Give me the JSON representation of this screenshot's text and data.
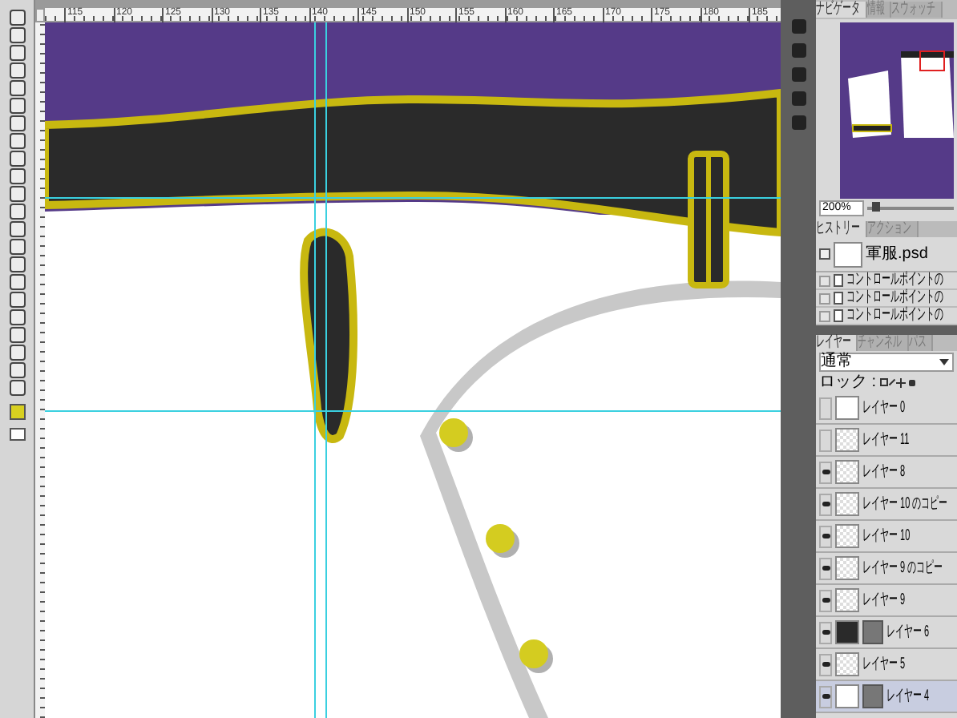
{
  "ruler": {
    "marks": [
      "115",
      "120",
      "125",
      "130",
      "135",
      "140",
      "145",
      "150",
      "155",
      "160",
      "165",
      "170",
      "175",
      "180",
      "185"
    ]
  },
  "navigator": {
    "tabs": [
      {
        "label": "ナビゲータ",
        "selected": true
      },
      {
        "label": "情報",
        "selected": false
      },
      {
        "label": "スウォッチ",
        "selected": false
      }
    ],
    "zoom": "200%",
    "zoom_slider": {
      "level": 0.1
    }
  },
  "history": {
    "tabs": [
      {
        "label": "ヒストリー",
        "selected": true
      },
      {
        "label": "アクション",
        "selected": false
      }
    ],
    "snapshot": "軍服.psd",
    "steps": [
      {
        "label": "コントロールポイントの",
        "checked": false
      },
      {
        "label": "コントロールポイントの",
        "checked": false
      },
      {
        "label": "コントロールポイントの",
        "checked": false
      }
    ]
  },
  "layers": {
    "tabs": [
      {
        "label": "レイヤー",
        "selected": true
      },
      {
        "label": "チャンネル",
        "selected": false
      },
      {
        "label": "パス",
        "selected": false
      }
    ],
    "blend_mode": "通常",
    "lock_label": "ロック :",
    "items": [
      {
        "name": "レイヤー 0",
        "visible": false,
        "selected": false,
        "kind": "sketch",
        "mask": false
      },
      {
        "name": "レイヤー 11",
        "visible": false,
        "selected": false,
        "kind": "transparent",
        "mask": false
      },
      {
        "name": "レイヤー 8",
        "visible": true,
        "selected": false,
        "kind": "transparent",
        "mask": false
      },
      {
        "name": "レイヤー 10 のコピー",
        "visible": true,
        "selected": false,
        "kind": "transparent",
        "mask": false
      },
      {
        "name": "レイヤー 10",
        "visible": true,
        "selected": false,
        "kind": "transparent",
        "mask": false
      },
      {
        "name": "レイヤー 9 のコピー",
        "visible": true,
        "selected": false,
        "kind": "transparent",
        "mask": false
      },
      {
        "name": "レイヤー 9",
        "visible": true,
        "selected": false,
        "kind": "transparent",
        "mask": false
      },
      {
        "name": "レイヤー 6",
        "visible": true,
        "selected": false,
        "kind": "dark",
        "mask": true
      },
      {
        "name": "レイヤー 5",
        "visible": true,
        "selected": false,
        "kind": "transparent",
        "mask": false
      },
      {
        "name": "レイヤー 4",
        "visible": true,
        "selected": true,
        "kind": "white",
        "mask": true
      }
    ]
  }
}
